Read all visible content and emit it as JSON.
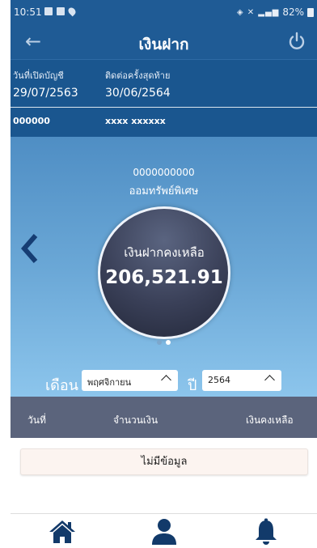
{
  "status_bar": {
    "time": "10:51",
    "battery": "82%",
    "signal_text": "૥ \u0001 ⁴ᴳ.ıl"
  },
  "header": {
    "title": "เงินฝาก",
    "back_icon": "arrow-left-icon",
    "power_icon": "power-icon"
  },
  "account": {
    "open_date_label": "วันที่เปิดบัญชี",
    "open_date": "29/07/2563",
    "last_contact_label": "ติดต่อครั้งสุดท้าย",
    "last_contact": "30/06/2564",
    "account_code": "000000",
    "account_name": "xxxx xxxxxx"
  },
  "summary": {
    "account_number": "0000000000",
    "account_type": "ออมทรัพย์พิเศษ",
    "balance_label": "เงินฝากคงเหลือ",
    "balance_value": "206,521.91",
    "page_count": 2,
    "active_page": 1
  },
  "filter": {
    "month_label": "เดือน",
    "month_value": "พฤศจิกายน",
    "year_label": "ปี",
    "year_value": "2564"
  },
  "table": {
    "headers": [
      "วันที่",
      "จำนวนเงิน",
      "เงินคงเหลือ"
    ],
    "empty_message": "ไม่มีข้อมูล"
  },
  "bottom_nav": {
    "items": [
      "home-icon",
      "user-icon",
      "bell-icon"
    ]
  },
  "colors": {
    "primary": "#1f5b95",
    "table_header": "#5b647c",
    "accent_dark": "#123a6a"
  }
}
